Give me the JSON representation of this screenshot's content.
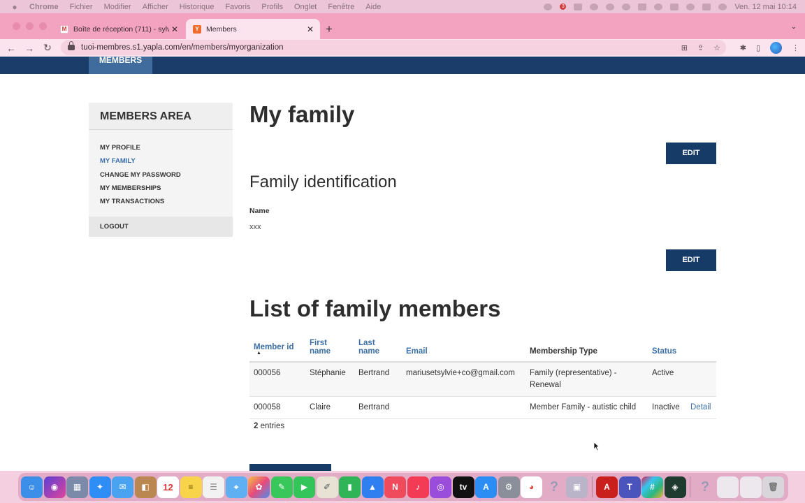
{
  "menubar": {
    "app_name": "Chrome",
    "items": [
      "Fichier",
      "Modifier",
      "Afficher",
      "Historique",
      "Favoris",
      "Profils",
      "Onglet",
      "Fenêtre",
      "Aide"
    ],
    "notification_badge": "3",
    "datetime": "Ven. 12 mai  10:14"
  },
  "browser": {
    "tabs": [
      {
        "title": "Boîte de réception (711) - sylvi",
        "favicon": "gmail-icon"
      },
      {
        "title": "Members",
        "favicon": "yapla-icon"
      }
    ],
    "url": "tuoi-membres.s1.yapla.com/en/members/myorganization"
  },
  "site": {
    "nav_tab": "MEMBERS"
  },
  "sidebar": {
    "title": "MEMBERS AREA",
    "items": [
      {
        "label": "MY PROFILE"
      },
      {
        "label": "MY FAMILY"
      },
      {
        "label": "CHANGE MY PASSWORD"
      },
      {
        "label": "MY MEMBERSHIPS"
      },
      {
        "label": "MY TRANSACTIONS"
      }
    ],
    "logout": "LOGOUT"
  },
  "main": {
    "title": "My family",
    "edit_label": "EDIT",
    "section_title": "Family identification",
    "name_label": "Name",
    "name_value": "xxx",
    "list_title": "List of family members",
    "table": {
      "headers": {
        "member_id": "Member id",
        "first_name": "First name",
        "last_name": "Last name",
        "email": "Email",
        "membership_type": "Membership Type",
        "status": "Status"
      },
      "rows": [
        {
          "member_id": "000056",
          "first_name": "Stéphanie",
          "last_name": "Bertrand",
          "email": "mariusetsylvie+co@gmail.com",
          "membership_type": "Family (representative) - Renewal",
          "status": "Active",
          "action": ""
        },
        {
          "member_id": "000058",
          "first_name": "Claire",
          "last_name": "Bertrand",
          "email": "",
          "membership_type": "Member Family - autistic child",
          "status": "Inactive",
          "action": "Detail"
        }
      ]
    },
    "entries_count": "2",
    "entries_label": " entries"
  },
  "dock": {
    "calendar_day": "12"
  }
}
